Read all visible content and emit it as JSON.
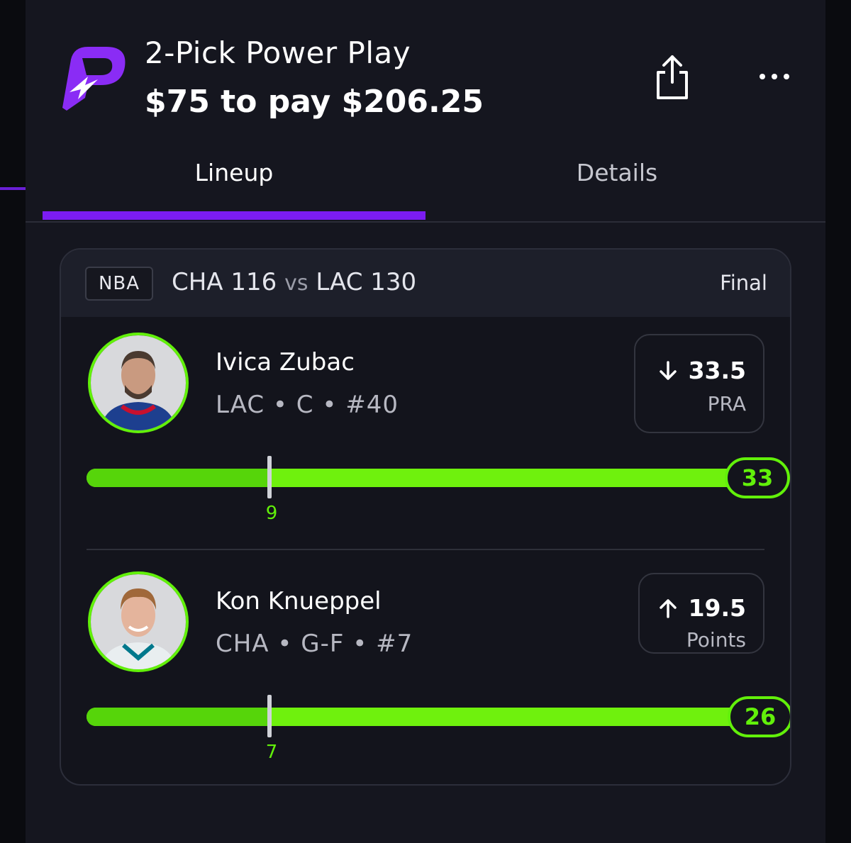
{
  "header": {
    "title": "2-Pick Power Play",
    "subtitle": "$75 to pay $206.25",
    "logo_icon": "prizepicks-logo",
    "share_icon": "share-icon",
    "more_icon": "more-icon"
  },
  "tabs": [
    {
      "label": "Lineup",
      "active": true
    },
    {
      "label": "Details",
      "active": false
    }
  ],
  "game": {
    "league": "NBA",
    "team1": "CHA",
    "score1": "116",
    "vs": "vs",
    "team2": "LAC",
    "score2": "130",
    "status": "Final"
  },
  "players": [
    {
      "name": "Ivica Zubac",
      "meta": "LAC • C • #40",
      "direction": "down",
      "line": "33.5",
      "stat": "PRA",
      "start_value": "9",
      "final_value": "33",
      "start_fraction": 0.27,
      "jersey_color": "#1d3f8f"
    },
    {
      "name": "Kon Knueppel",
      "meta": "CHA • G-F • #7",
      "direction": "up",
      "line": "19.5",
      "stat": "Points",
      "start_value": "7",
      "final_value": "26",
      "start_fraction": 0.27,
      "jersey_color": "#e9eef0"
    }
  ],
  "colors": {
    "accent_purple": "#7b1cf1",
    "progress_green": "#6ff10d",
    "ring_green": "#62f00a"
  }
}
